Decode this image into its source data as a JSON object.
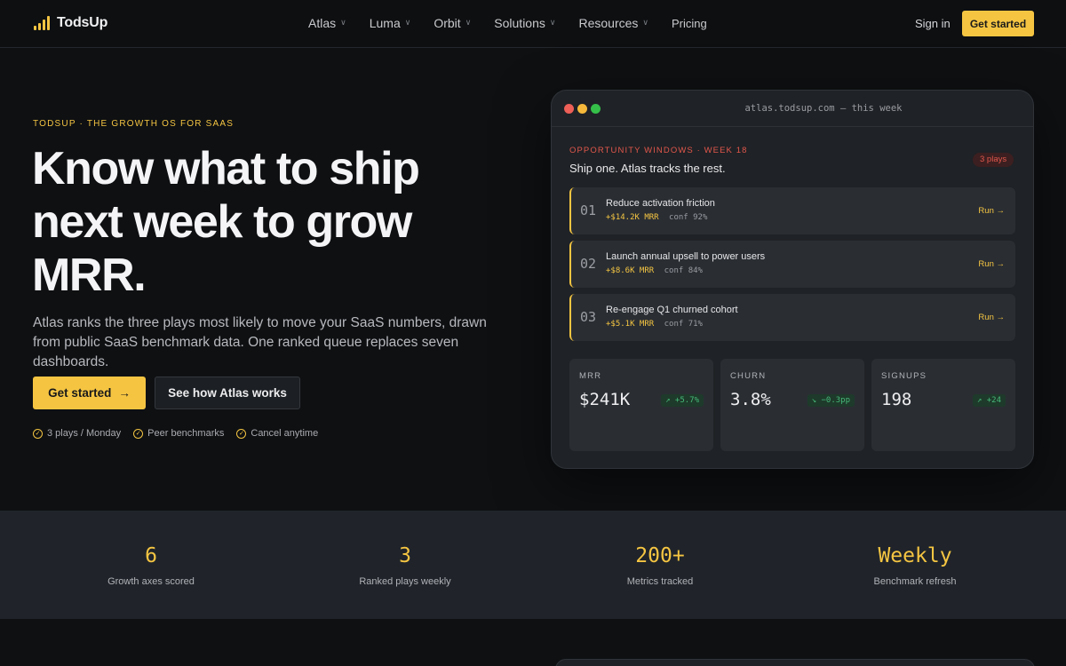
{
  "nav": {
    "brand": "TodsUp",
    "links": [
      {
        "label": "Atlas",
        "dropdown": true
      },
      {
        "label": "Luma",
        "dropdown": true
      },
      {
        "label": "Orbit",
        "dropdown": true
      },
      {
        "label": "Solutions",
        "dropdown": true
      },
      {
        "label": "Resources",
        "dropdown": true
      },
      {
        "label": "Pricing",
        "dropdown": false
      }
    ],
    "sign_in": "Sign in",
    "cta": "Get started"
  },
  "hero": {
    "eyebrow": "TODSUP · THE GROWTH OS FOR SAAS",
    "headline": "Know what to ship next week to grow MRR.",
    "lede": "Atlas ranks the three plays most likely to move your SaaS numbers, drawn from public SaaS benchmark data. One ranked queue replaces seven dashboards.",
    "primary_cta": "Get started",
    "primary_arrow": "→",
    "secondary_cta": "See how Atlas works",
    "bullets": [
      "3 plays / Monday",
      "Peer benchmarks",
      "Cancel anytime"
    ]
  },
  "panel": {
    "url": "atlas.todsup.com — this week",
    "section_label": "OPPORTUNITY WINDOWS · WEEK 18",
    "subtitle": "Ship one. Atlas tracks the rest.",
    "badge": "3 plays",
    "plays": [
      {
        "num": "01",
        "title": "Reduce activation friction",
        "amount": "+$14.2K MRR",
        "conf": "conf 92%",
        "action": "Run →"
      },
      {
        "num": "02",
        "title": "Launch annual upsell to power users",
        "amount": "+$8.6K MRR",
        "conf": "conf 84%",
        "action": "Run →"
      },
      {
        "num": "03",
        "title": "Re-engage Q1 churned cohort",
        "amount": "+$5.1K MRR",
        "conf": "conf 71%",
        "action": "Run →"
      }
    ],
    "metrics": [
      {
        "label": "MRR",
        "value": "$241K",
        "delta": "↗ +5.7%"
      },
      {
        "label": "CHURN",
        "value": "3.8%",
        "delta": "↘ −0.3pp"
      },
      {
        "label": "SIGNUPS",
        "value": "198",
        "delta": "↗ +24"
      }
    ]
  },
  "stats": [
    {
      "value": "6",
      "label": "Growth axes scored"
    },
    {
      "value": "3",
      "label": "Ranked plays weekly"
    },
    {
      "value": "200+",
      "label": "Metrics tracked"
    },
    {
      "value": "Weekly",
      "label": "Benchmark refresh"
    }
  ],
  "colors": {
    "accent": "#f5c542",
    "alert": "#e2574c",
    "positive": "#46b97a",
    "background": "#0e1012"
  }
}
